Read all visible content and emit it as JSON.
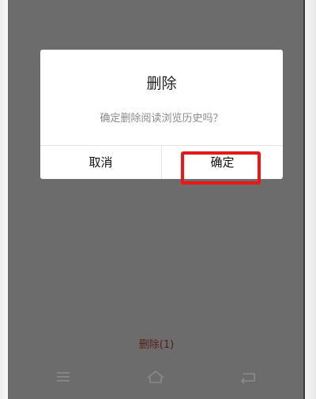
{
  "dialog": {
    "title": "删除",
    "message": "确定删除阅读浏览历史吗？",
    "cancel_label": "取消",
    "confirm_label": "确定"
  },
  "page": {
    "delete_action_label": "删除(1)"
  },
  "nav": {
    "menu_icon": "menu-icon",
    "home_icon": "home-icon",
    "back_icon": "back-icon"
  },
  "colors": {
    "overlay": "#6c6c6c",
    "highlight": "#f01414",
    "delete_action": "#5a1c18"
  }
}
